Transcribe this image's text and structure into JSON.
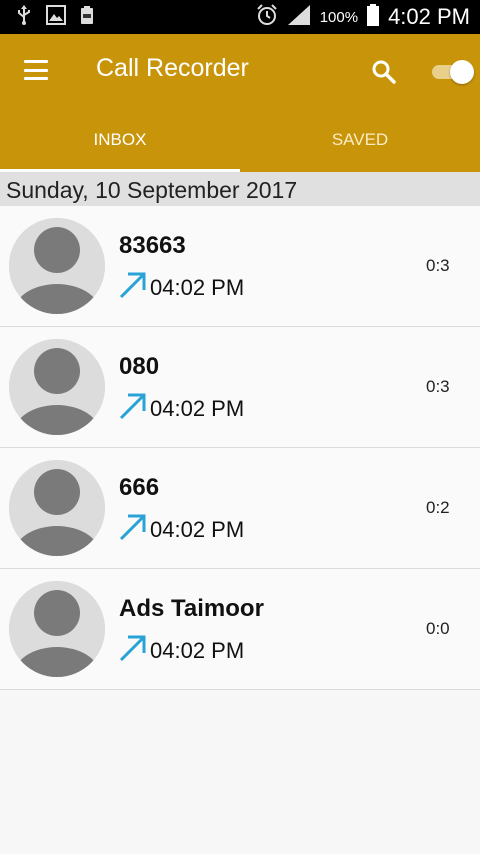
{
  "status_bar": {
    "battery_percent": "100%",
    "time": "4:02 PM",
    "icons": [
      "usb-icon",
      "image-icon",
      "battery-small-icon",
      "alarm-icon",
      "signal-icon",
      "battery-icon"
    ]
  },
  "app_bar": {
    "title": "Call Recorder",
    "menu_icon": "hamburger-menu-icon",
    "search_icon": "search-icon",
    "recording_toggle_on": true,
    "color": "#c8940a"
  },
  "tabs": [
    {
      "label": "INBOX",
      "active": true
    },
    {
      "label": "SAVED",
      "active": false
    }
  ],
  "date_header": "Sunday, 10 September 2017",
  "calls": [
    {
      "name": "83663",
      "time": "04:02 PM",
      "duration": "0:3",
      "direction": "outgoing"
    },
    {
      "name": "080",
      "time": "04:02 PM",
      "duration": "0:3",
      "direction": "outgoing"
    },
    {
      "name": "666",
      "time": "04:02 PM",
      "duration": "0:2",
      "direction": "outgoing"
    },
    {
      "name": "Ads Taimoor",
      "time": "04:02 PM",
      "duration": "0:0",
      "direction": "outgoing"
    }
  ],
  "colors": {
    "accent": "#c8940a",
    "outgoing_arrow": "#29a3d6"
  }
}
